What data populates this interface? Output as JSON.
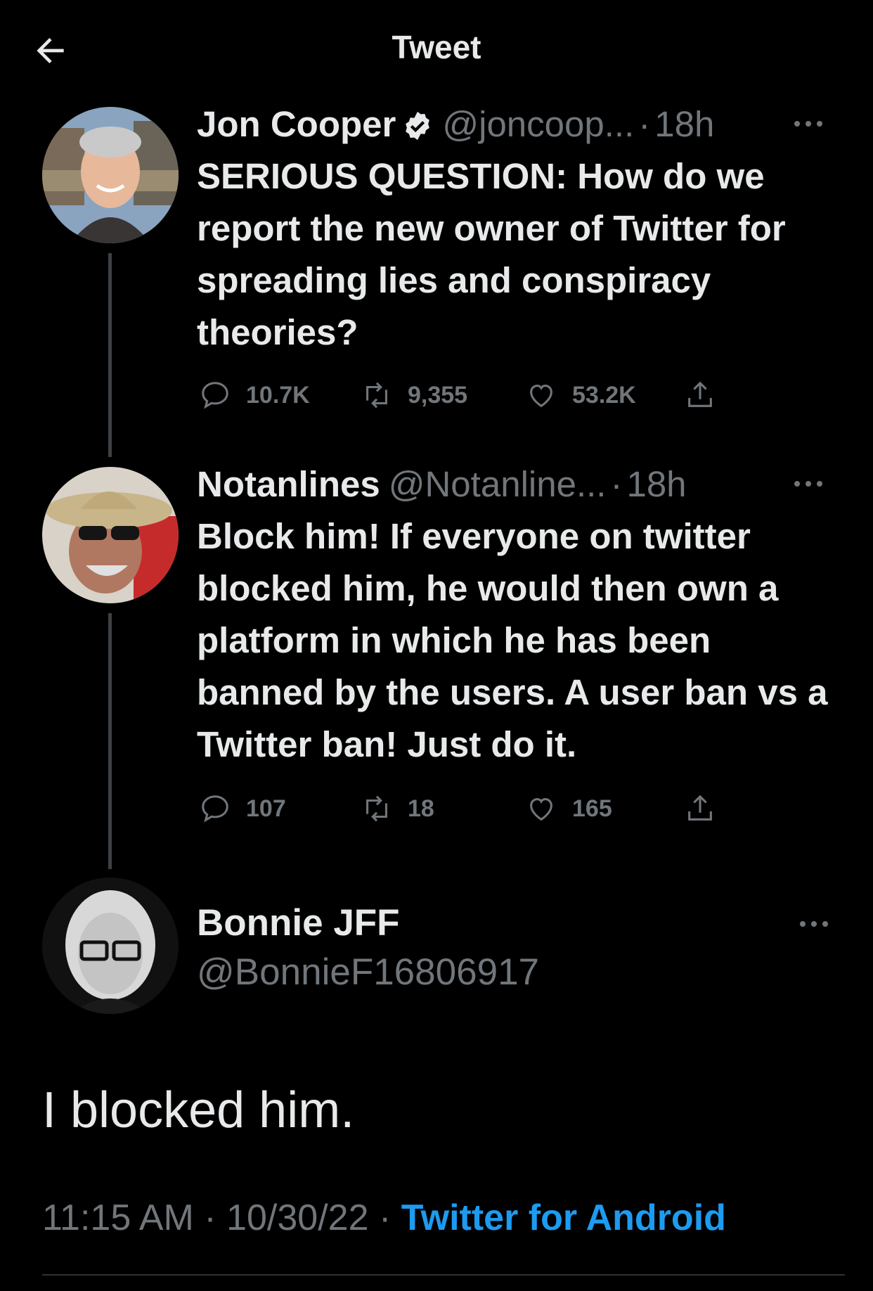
{
  "header": {
    "title": "Tweet",
    "back_icon": "arrow-left-icon"
  },
  "colors": {
    "background": "#000000",
    "text": "#e7e9ea",
    "muted": "#71767b",
    "link": "#1d9bf0",
    "thread_line": "#3e4144"
  },
  "tweets": [
    {
      "name": "Jon Cooper",
      "verified": true,
      "handle": "@joncoop...",
      "separator": "·",
      "time": "18h",
      "text": "SERIOUS QUESTION: How do we report the new owner of Twitter for spreading lies and conspiracy theories?",
      "replies": "10.7K",
      "retweets": "9,355",
      "likes": "53.2K"
    },
    {
      "name": "Notanlines",
      "verified": false,
      "handle": "@Notanline...",
      "separator": "·",
      "time": "18h",
      "text": "Block him!  If everyone on twitter blocked him, he would then own a platform in which he has been banned by the users.  A user ban vs a Twitter ban!  Just do it.",
      "replies": "107",
      "retweets": "18",
      "likes": "165"
    }
  ],
  "main_tweet": {
    "name": "Bonnie JFF",
    "handle": "@BonnieF16806917",
    "text": "I blocked him.",
    "time": "11:15 AM",
    "separator": "·",
    "date": "10/30/22",
    "source": "Twitter for Android"
  }
}
